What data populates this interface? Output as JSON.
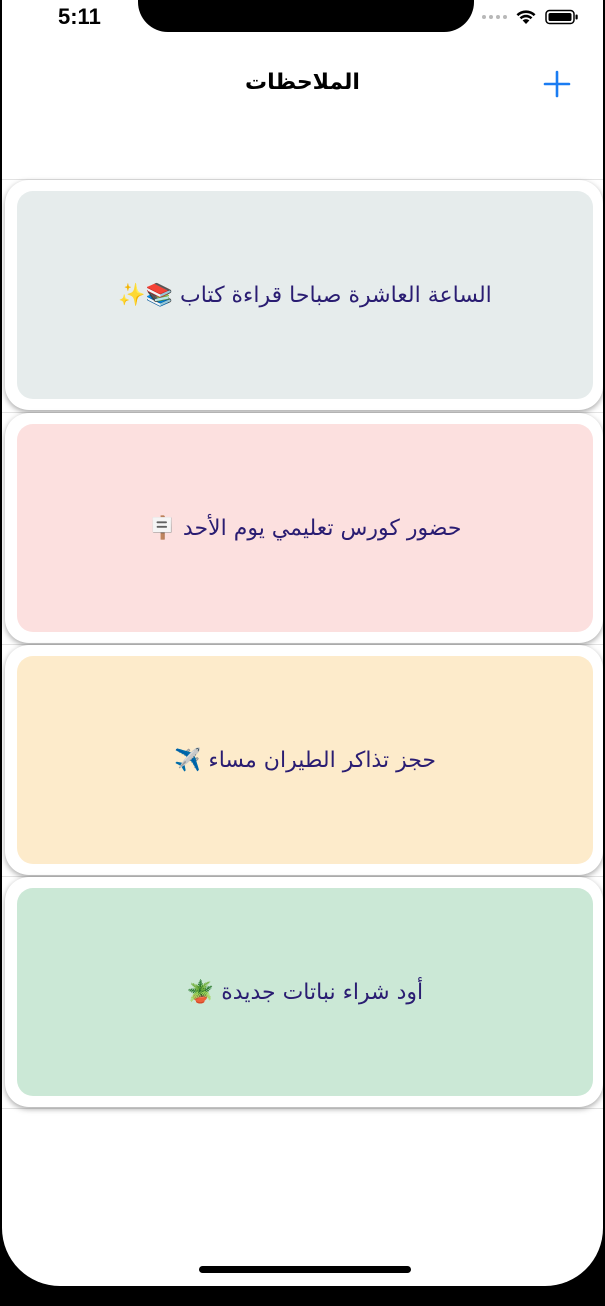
{
  "status_bar": {
    "time": "5:11"
  },
  "nav": {
    "title": "الملاحظات",
    "add_icon": "plus-icon"
  },
  "notes": [
    {
      "text": "الساعة العاشرة صباحا قراءة كتاب 📚✨",
      "color": "#E6ECEC"
    },
    {
      "text": "حضور كورس تعليمي يوم الأحد 🪧",
      "color": "#FCE0DF"
    },
    {
      "text": "حجز تذاكر الطيران مساء ✈️",
      "color": "#FDEBCB"
    },
    {
      "text": "أود شراء نباتات جديدة 🪴",
      "color": "#CBE8D6"
    }
  ],
  "colors": {
    "accent": "#1A7CF2",
    "note_text": "#2A1D72"
  }
}
